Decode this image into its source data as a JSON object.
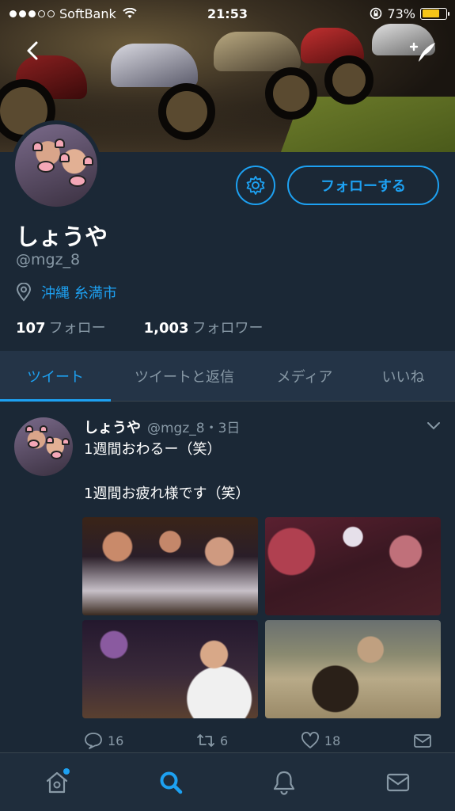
{
  "status_bar": {
    "carrier": "SoftBank",
    "time": "21:53",
    "battery_percent": "73%",
    "battery_level": 0.73,
    "icons": [
      "signal-dots-icon",
      "wifi-icon",
      "rotation-lock-icon",
      "battery-icon"
    ]
  },
  "header": {
    "back_icon": "chevron-left-icon",
    "compose_icon": "compose-tweet-icon"
  },
  "profile": {
    "display_name": "しょうや",
    "handle": "@mgz_8",
    "location": "沖縄 糸満市",
    "following_count": "107",
    "following_label": "フォロー",
    "followers_count": "1,003",
    "followers_label": "フォロワー",
    "follow_button": "フォローする",
    "settings_icon": "gear-icon"
  },
  "tabs": [
    {
      "label": "ツイート",
      "active": true
    },
    {
      "label": "ツイートと返信",
      "active": false
    },
    {
      "label": "メディア",
      "active": false
    },
    {
      "label": "いいね",
      "active": false
    }
  ],
  "tweet": {
    "name": "しょうや",
    "meta": "@mgz_8・3日",
    "text": "1週間おわるー（笑）\n\n1週間お疲れ様です（笑）",
    "replies": "16",
    "retweets": "6",
    "likes": "18",
    "photo_count": 4
  },
  "bottom_nav": [
    "home-icon",
    "search-icon",
    "notifications-bell-icon",
    "messages-envelope-icon"
  ],
  "colors": {
    "accent": "#1da1f2",
    "background": "#1b2836",
    "tab_bar": "#243447",
    "muted_text": "#8899a6"
  }
}
